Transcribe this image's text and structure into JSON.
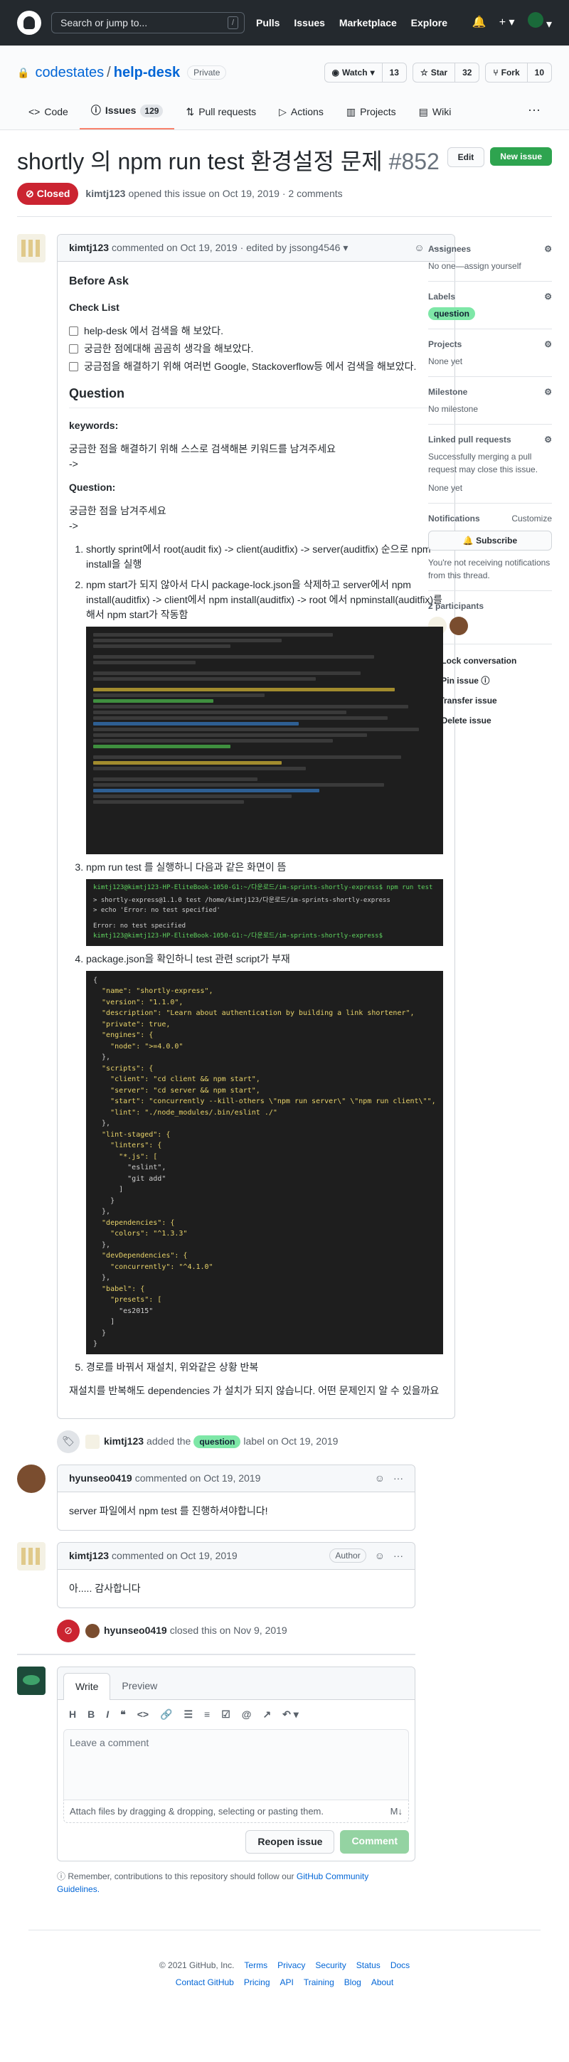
{
  "topbar": {
    "search_placeholder": "Search or jump to...",
    "slash": "/",
    "nav": [
      "Pulls",
      "Issues",
      "Marketplace",
      "Explore"
    ]
  },
  "repo": {
    "owner": "codestates",
    "name": "help-desk",
    "visibility": "Private",
    "watch": {
      "label": "Watch",
      "count": "13"
    },
    "star": {
      "label": "Star",
      "count": "32"
    },
    "fork": {
      "label": "Fork",
      "count": "10"
    },
    "tabs": [
      {
        "label": "Code"
      },
      {
        "label": "Issues",
        "count": "129"
      },
      {
        "label": "Pull requests"
      },
      {
        "label": "Actions"
      },
      {
        "label": "Projects"
      },
      {
        "label": "Wiki"
      }
    ]
  },
  "issue": {
    "title": "shortly 의 npm run test 환경설정 문제",
    "number": "#852",
    "edit": "Edit",
    "new_issue": "New issue",
    "status": "Closed",
    "author": "kimtj123",
    "opened_text": "opened this issue on Oct 19, 2019 · 2 comments"
  },
  "first_comment": {
    "author": "kimtj123",
    "meta": "commented on Oct 19, 2019 · edited by jssong4546 ▾",
    "before_ask": "Before Ask",
    "check_list": "Check List",
    "checks": [
      "help-desk 에서 검색을 해 보았다.",
      "궁금한 점에대해 곰곰히 생각을 해보았다.",
      "궁금점을 해결하기 위해 여러번 Google, Stackoverflow등 에서 검색을 해보았다."
    ],
    "question_heading": "Question",
    "keywords_heading": "keywords:",
    "keywords_text": "궁금한 점을 해결하기 위해 스스로 검색해본 키워드를 남겨주세요",
    "arrow1": "->",
    "question_sub": "Question:",
    "question_text": "궁금한 점을 남겨주세요",
    "arrow2": "->",
    "steps": [
      "shortly sprint에서 root(audit fix) -> client(auditfix) -> server(auditfix) 순으로 npm install을 실행",
      "npm start가 되지 않아서 다시 package-lock.json을 삭제하고 server에서 npm install(auditfix) -> client에서 npm install(auditfix) -> root 에서 npminstall(auditfix)를 해서 npm start가 작동함",
      "npm run test 를 실행하니 다음과 같은 화면이 뜸",
      "package.json을 확인하니 test 관련 script가 부재",
      "경로를 바꿔서 재설치, 위와같은 상황 반복"
    ],
    "term2": {
      "line1": "kimtj123@kimtj123-HP-EliteBook-1050-G1:~/다운로드/im-sprints-shortly-express$ npm run test",
      "line2": "> shortly-express@1.1.0 test /home/kimtj123/다운로드/im-sprints-shortly-express",
      "line3": "> echo 'Error: no test specified'",
      "line4": "Error: no test specified",
      "line5": "kimtj123@kimtj123-HP-EliteBook-1050-G1:~/다운로드/im-sprints-shortly-express$"
    },
    "package_json": [
      "{",
      "  \"name\": \"shortly-express\",",
      "  \"version\": \"1.1.0\",",
      "  \"description\": \"Learn about authentication by building a link shortener\",",
      "  \"private\": true,",
      "  \"engines\": {",
      "    \"node\": \">=4.0.0\"",
      "  },",
      "  \"scripts\": {",
      "    \"client\": \"cd client && npm start\",",
      "    \"server\": \"cd server && npm start\",",
      "    \"start\": \"concurrently --kill-others \\\"npm run server\\\" \\\"npm run client\\\"\",",
      "    \"lint\": \"./node_modules/.bin/eslint ./\"",
      "  },",
      "  \"lint-staged\": {",
      "    \"linters\": {",
      "      \"*.js\": [",
      "        \"eslint\",",
      "        \"git add\"",
      "      ]",
      "    }",
      "  },",
      "  \"dependencies\": {",
      "    \"colors\": \"^1.3.3\"",
      "  },",
      "  \"devDependencies\": {",
      "    \"concurrently\": \"^4.1.0\"",
      "  },",
      "  \"babel\": {",
      "    \"presets\": [",
      "      \"es2015\"",
      "    ]",
      "  }",
      "}"
    ],
    "closing": "재설치를 반복해도 dependencies 가 설치가 되지 않습니다. 어떤 문제인지 알 수 있을까요"
  },
  "label_event": {
    "author": "kimtj123",
    "pre": "added the",
    "label": "question",
    "post": "label on Oct 19, 2019"
  },
  "comment2": {
    "author": "hyunseo0419",
    "meta": "commented on Oct 19, 2019",
    "body": "server 파일에서 npm test 를 진행하셔야합니다!"
  },
  "comment3": {
    "author": "kimtj123",
    "meta": "commented on Oct 19, 2019",
    "badge": "Author",
    "body": "아..... 감사합니다"
  },
  "close_event": {
    "author": "hyunseo0419",
    "text": "closed this on Nov 9, 2019"
  },
  "new_comment": {
    "write": "Write",
    "preview": "Preview",
    "placeholder": "Leave a comment",
    "attach": "Attach files by dragging & dropping, selecting or pasting them.",
    "md": "M↓",
    "reopen": "Reopen issue",
    "comment": "Comment",
    "remember": "Remember, contributions to this repository should follow our",
    "guidelines": "GitHub Community Guidelines."
  },
  "sidebar": {
    "assignees": {
      "title": "Assignees",
      "value": "No one—assign yourself"
    },
    "labels": {
      "title": "Labels",
      "value": "question"
    },
    "projects": {
      "title": "Projects",
      "value": "None yet"
    },
    "milestone": {
      "title": "Milestone",
      "value": "No milestone"
    },
    "linked": {
      "title": "Linked pull requests",
      "value": "Successfully merging a pull request may close this issue.",
      "none": "None yet"
    },
    "notifications": {
      "title": "Notifications",
      "customize": "Customize",
      "subscribe": "Subscribe",
      "desc": "You're not receiving notifications from this thread."
    },
    "participants": "2 participants",
    "actions": [
      "Lock conversation",
      "Pin issue",
      "Transfer issue",
      "Delete issue"
    ]
  },
  "footer": {
    "copyright": "© 2021 GitHub, Inc.",
    "links1": [
      "Terms",
      "Privacy",
      "Security",
      "Status",
      "Docs"
    ],
    "links2": [
      "Contact GitHub",
      "Pricing",
      "API",
      "Training",
      "Blog",
      "About"
    ]
  }
}
